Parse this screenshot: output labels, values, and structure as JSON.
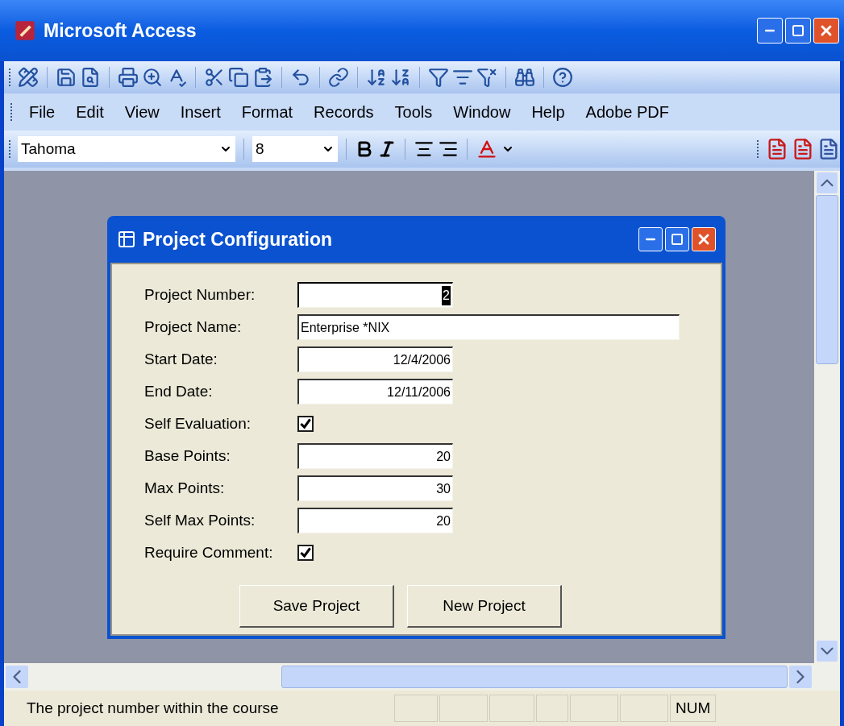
{
  "window": {
    "title": "Microsoft Access"
  },
  "menu": [
    {
      "label": "File"
    },
    {
      "label": "Edit"
    },
    {
      "label": "View"
    },
    {
      "label": "Insert"
    },
    {
      "label": "Format"
    },
    {
      "label": "Records"
    },
    {
      "label": "Tools"
    },
    {
      "label": "Window"
    },
    {
      "label": "Help"
    },
    {
      "label": "Adobe PDF"
    }
  ],
  "format_toolbar": {
    "font": "Tahoma",
    "size": "8"
  },
  "form": {
    "title": "Project Configuration",
    "fields": [
      {
        "label": "Project Number:",
        "kind": "number",
        "value": "2",
        "focused": true
      },
      {
        "label": "Project Name:",
        "kind": "text",
        "value": "Enterprise *NIX",
        "focused": false
      },
      {
        "label": "Start Date:",
        "kind": "number",
        "value": "12/4/2006",
        "focused": false
      },
      {
        "label": "End Date:",
        "kind": "number",
        "value": "12/11/2006",
        "focused": false
      },
      {
        "label": "Self Evaluation:",
        "kind": "checkbox",
        "checked": true
      },
      {
        "label": "Base Points:",
        "kind": "number",
        "value": "20",
        "focused": false
      },
      {
        "label": "Max Points:",
        "kind": "number",
        "value": "30",
        "focused": false
      },
      {
        "label": "Self Max Points:",
        "kind": "number",
        "value": "20",
        "focused": false
      },
      {
        "label": "Require Comment:",
        "kind": "checkbox",
        "checked": true
      }
    ],
    "buttons": [
      "Save Project",
      "New Project"
    ]
  },
  "status_bar": {
    "message": "The project number within the course",
    "indicator": "NUM"
  }
}
